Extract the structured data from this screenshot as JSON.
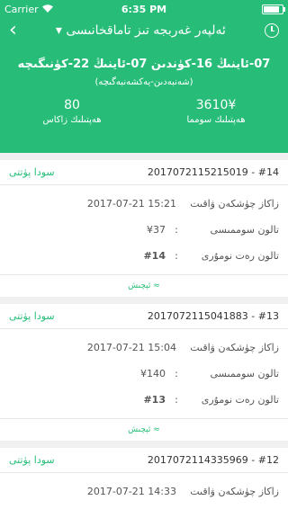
{
  "status_bar": {
    "carrier": "Carrier",
    "time": "6:35 PM",
    "battery_level": 0.9
  },
  "nav": {
    "title": "ئەلپەر غەربجە تىز تاماقخانىسى ▾"
  },
  "summary": {
    "date_range": "07-ئاينىڭ 16-كۈندىن  07-ئاينىڭ 22-كۈنىگىچە",
    "subtitle": "(شەنبەدىن-يەكشەنبەگىچە)",
    "total_amount": "3610¥",
    "total_amount_label": "ھەپتىلىك سومما",
    "total_count": "80",
    "total_count_label": "ھەپتىلىك زاكاس"
  },
  "labels": {
    "order_time": "زاكاز چۈشكەن ۋاقىت",
    "coupon_amount": "تالون سوممىسى",
    "coupon_number": "تالون رەت نومۇرى",
    "expand": "ئېچىش ≈",
    "colon": ":"
  },
  "orders": [
    {
      "number": "#14",
      "order_id": "20170721152150​19",
      "status": "سودا پۈتتى",
      "time": "2017-07-21 15:21",
      "amount": "¥37",
      "coupon_no": "#14"
    },
    {
      "number": "#13",
      "order_id": "2017072115041883",
      "status": "سودا پۈتتى",
      "time": "2017-07-21 15:04",
      "amount": "¥140",
      "coupon_no": "#13"
    },
    {
      "number": "#12",
      "order_id": "2017072114335969",
      "status": "سودا پۈتتى",
      "time": "2017-07-21 14:33"
    }
  ]
}
